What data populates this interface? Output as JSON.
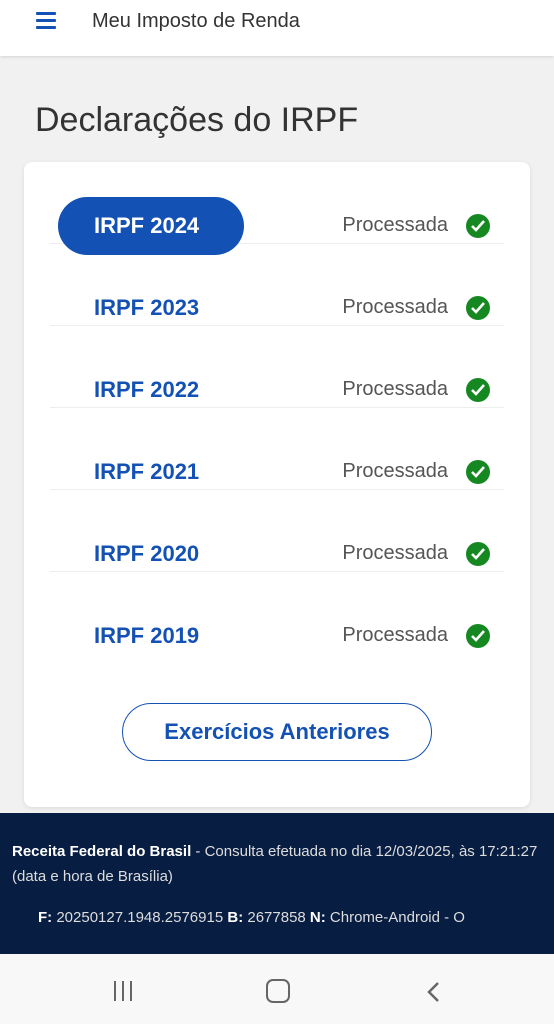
{
  "header": {
    "title": "Meu Imposto de Renda",
    "menu_icon": "hamburger-menu-icon"
  },
  "page": {
    "title": "Declarações do IRPF"
  },
  "declarations": [
    {
      "year": "IRPF 2024",
      "status": "Processada",
      "active": true
    },
    {
      "year": "IRPF 2023",
      "status": "Processada",
      "active": false
    },
    {
      "year": "IRPF 2022",
      "status": "Processada",
      "active": false
    },
    {
      "year": "IRPF 2021",
      "status": "Processada",
      "active": false
    },
    {
      "year": "IRPF 2020",
      "status": "Processada",
      "active": false
    },
    {
      "year": "IRPF 2019",
      "status": "Processada",
      "active": false
    }
  ],
  "button_anteriores": "Exercícios Anteriores",
  "footer": {
    "org": "Receita Federal do Brasil",
    "consulta": " - Consulta efetuada no dia 12/03/2025, às 17:21:27 (data e hora de Brasília)",
    "f_label": "F:",
    "f_value": " 20250127.1948.2576915 ",
    "b_label": "B:",
    "b_value": " 2677858 ",
    "n_label": "N:",
    "n_value": " Chrome-Android - O"
  },
  "colors": {
    "primary": "#1351b4",
    "success": "#168821",
    "footer_bg": "#071d41"
  }
}
